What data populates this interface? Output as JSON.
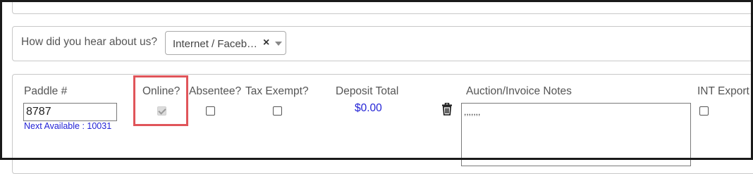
{
  "source": {
    "label": "How did you hear about us?",
    "selected": "Internet / Faceb…",
    "clear_glyph": "×"
  },
  "bidder": {
    "paddle_label": "Paddle #",
    "paddle_value": "8787",
    "next_available": "Next Available : 10031",
    "online_label": "Online?",
    "online_checked": true,
    "online_disabled": true,
    "absentee_label": "Absentee?",
    "absentee_checked": false,
    "tax_exempt_label": "Tax Exempt?",
    "tax_exempt_checked": false,
    "deposit_label": "Deposit Total",
    "deposit_value": "$0.00",
    "notes_label": "Auction/Invoice Notes",
    "notes_value": ",,,,,,,",
    "int_export_label": "INT Export",
    "int_export_checked": false
  },
  "icons": {
    "trash": "trash-icon",
    "dropdown": "chevron-down-icon"
  },
  "colors": {
    "highlight": "#e0555a",
    "link_blue": "#2323d6"
  }
}
